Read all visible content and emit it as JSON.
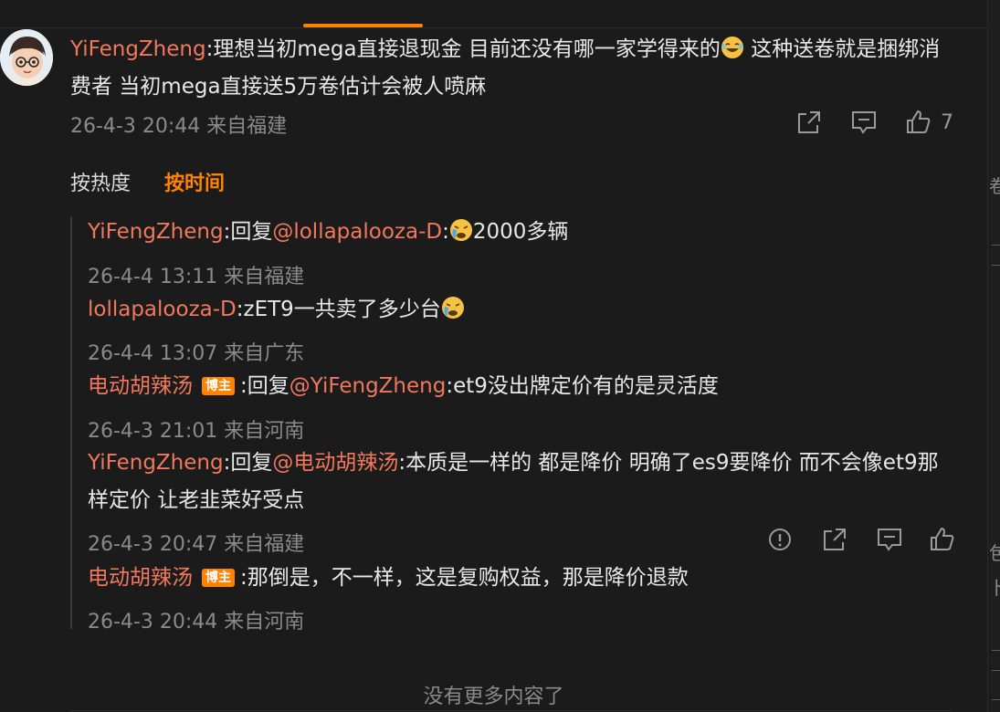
{
  "main_comment": {
    "username": "YiFengZheng",
    "separator": ":",
    "text_part1": "理想当初mega直接退现金 目前还没有哪一家学得来的",
    "emoji_1": "laughing-tears-emoji",
    "text_part2": " 这种送卷就是捆绑消费者 当初mega直接送5万卷估计会被人喷麻",
    "meta": "26-4-3 20:44 来自福建",
    "like_count": "7"
  },
  "sort": {
    "by_hot": "按热度",
    "by_time": "按时间"
  },
  "replies": [
    {
      "username": "YiFengZheng",
      "sep1": ":",
      "reply_prefix": "回复",
      "mention": "@lollapalooza-D",
      "sep2": ":",
      "text": "2000多辆",
      "emoji": "crying-face-emoji",
      "meta": "26-4-4 13:11 来自福建"
    },
    {
      "username": "lollapalooza-D",
      "sep1": ":",
      "text": "zET9一共卖了多少台",
      "emoji": "crying-face-emoji",
      "meta": "26-4-4 13:07 来自广东"
    },
    {
      "username": "电动胡辣汤",
      "badge": "博主",
      "sep1": ":",
      "reply_prefix": "回复",
      "mention": "@YiFengZheng",
      "sep2": ":",
      "text": "et9没出牌定价有的是灵活度",
      "meta": "26-4-3 21:01 来自河南"
    },
    {
      "username": "YiFengZheng",
      "sep1": ":",
      "reply_prefix": "回复",
      "mention": "@电动胡辣汤",
      "sep2": ":",
      "text": "本质是一样的 都是降价 明确了es9要降价 而不会像et9那样定价 让老韭菜好受点",
      "meta": "26-4-3 20:47 来自福建"
    },
    {
      "username": "电动胡辣汤",
      "badge": "博主",
      "sep1": ":",
      "text": "那倒是，不一样，这是复购权益，那是降价退款",
      "meta": "26-4-3 20:44 来自河南"
    }
  ],
  "end_text": "没有更多内容了",
  "right_edge_chars": [
    "卷",
    "包",
    "卜"
  ],
  "colors": {
    "accent": "#ff8200",
    "username": "#f1785c",
    "background": "#1b1b1b",
    "meta": "#8a8a8a"
  },
  "icons": [
    "share-icon",
    "comment-icon",
    "like-icon",
    "report-icon"
  ]
}
